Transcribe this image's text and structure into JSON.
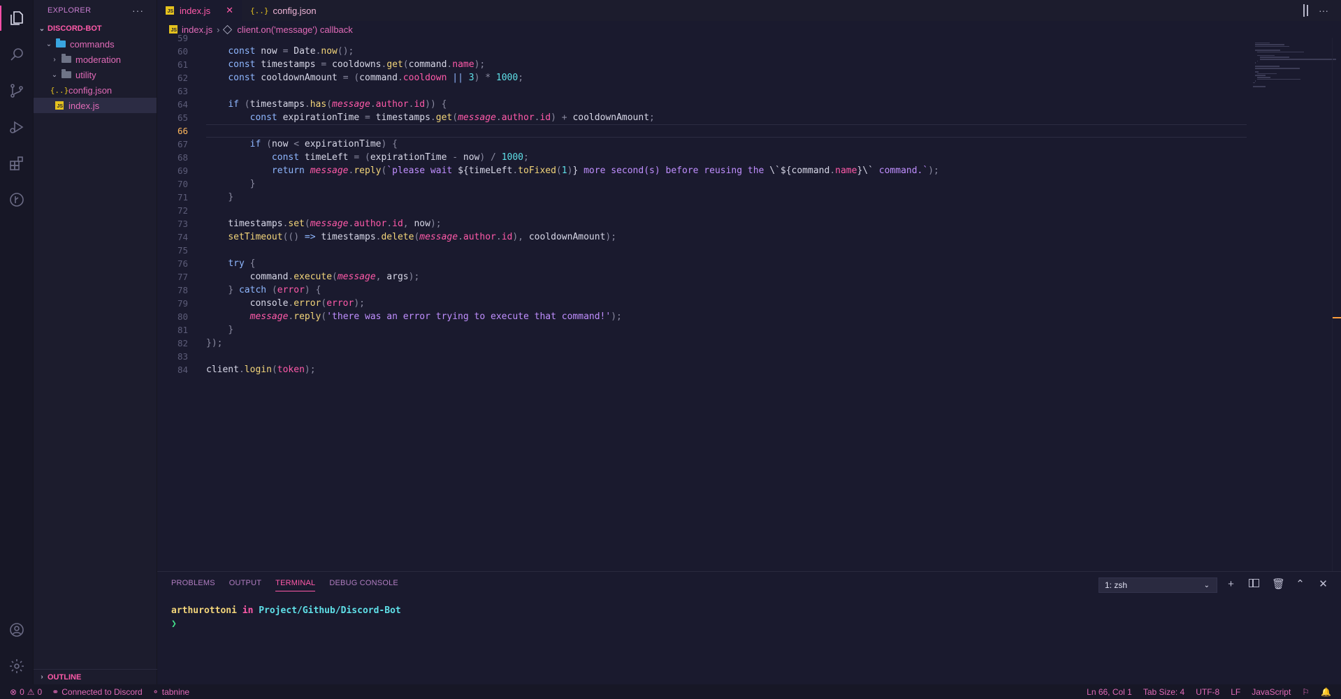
{
  "sidebar": {
    "title": "EXPLORER",
    "more": "···",
    "root": "DISCORD-BOT",
    "items": [
      {
        "label": "commands",
        "type": "folder-open"
      },
      {
        "label": "moderation",
        "type": "folder"
      },
      {
        "label": "utility",
        "type": "folder-open"
      },
      {
        "label": "config.json",
        "type": "json"
      },
      {
        "label": "index.js",
        "type": "js"
      }
    ],
    "outline": "OUTLINE"
  },
  "tabs": [
    {
      "label": "index.js",
      "active": true
    },
    {
      "label": "config.json",
      "active": false
    }
  ],
  "tab_close": "✕",
  "breadcrumb": {
    "file": "index.js",
    "symbol": "client.on('message') callback"
  },
  "editor": {
    "current_line": 66,
    "lines": [
      {
        "n": "59",
        "tokens": []
      },
      {
        "n": "60",
        "tokens": [
          [
            "tx",
            "    "
          ],
          [
            "kw",
            "const"
          ],
          [
            "tx",
            " now "
          ],
          [
            "op",
            "="
          ],
          [
            "tx",
            " Date"
          ],
          [
            "op",
            "."
          ],
          [
            "fn",
            "now"
          ],
          [
            "op",
            "();"
          ]
        ]
      },
      {
        "n": "61",
        "tokens": [
          [
            "tx",
            "    "
          ],
          [
            "kw",
            "const"
          ],
          [
            "tx",
            " timestamps "
          ],
          [
            "op",
            "="
          ],
          [
            "tx",
            " cooldowns"
          ],
          [
            "op",
            "."
          ],
          [
            "fn",
            "get"
          ],
          [
            "op",
            "("
          ],
          [
            "tx",
            "command"
          ],
          [
            "op",
            "."
          ],
          [
            "pr",
            "name"
          ],
          [
            "op",
            ");"
          ]
        ]
      },
      {
        "n": "62",
        "tokens": [
          [
            "tx",
            "    "
          ],
          [
            "kw",
            "const"
          ],
          [
            "tx",
            " cooldownAmount "
          ],
          [
            "op",
            "="
          ],
          [
            "tx",
            " "
          ],
          [
            "op",
            "("
          ],
          [
            "tx",
            "command"
          ],
          [
            "op",
            "."
          ],
          [
            "pr",
            "cooldown"
          ],
          [
            "tx",
            " "
          ],
          [
            "kw",
            "||"
          ],
          [
            "tx",
            " "
          ],
          [
            "num",
            "3"
          ],
          [
            "op",
            ")"
          ],
          [
            "tx",
            " "
          ],
          [
            "op",
            "*"
          ],
          [
            "tx",
            " "
          ],
          [
            "num",
            "1000"
          ],
          [
            "op",
            ";"
          ]
        ]
      },
      {
        "n": "63",
        "tokens": []
      },
      {
        "n": "64",
        "tokens": [
          [
            "tx",
            "    "
          ],
          [
            "kw",
            "if"
          ],
          [
            "tx",
            " "
          ],
          [
            "op",
            "("
          ],
          [
            "tx",
            "timestamps"
          ],
          [
            "op",
            "."
          ],
          [
            "fn",
            "has"
          ],
          [
            "op",
            "("
          ],
          [
            "it",
            "message"
          ],
          [
            "op",
            "."
          ],
          [
            "pr",
            "author"
          ],
          [
            "op",
            "."
          ],
          [
            "pr",
            "id"
          ],
          [
            "op",
            "))"
          ],
          [
            "tx",
            " "
          ],
          [
            "op",
            "{"
          ]
        ]
      },
      {
        "n": "65",
        "tokens": [
          [
            "tx",
            "        "
          ],
          [
            "kw",
            "const"
          ],
          [
            "tx",
            " expirationTime "
          ],
          [
            "op",
            "="
          ],
          [
            "tx",
            " timestamps"
          ],
          [
            "op",
            "."
          ],
          [
            "fn",
            "get"
          ],
          [
            "op",
            "("
          ],
          [
            "it",
            "message"
          ],
          [
            "op",
            "."
          ],
          [
            "pr",
            "author"
          ],
          [
            "op",
            "."
          ],
          [
            "pr",
            "id"
          ],
          [
            "op",
            ")"
          ],
          [
            "tx",
            " "
          ],
          [
            "op",
            "+"
          ],
          [
            "tx",
            " cooldownAmount"
          ],
          [
            "op",
            ";"
          ]
        ]
      },
      {
        "n": "66",
        "tokens": []
      },
      {
        "n": "67",
        "tokens": [
          [
            "tx",
            "        "
          ],
          [
            "kw",
            "if"
          ],
          [
            "tx",
            " "
          ],
          [
            "op",
            "("
          ],
          [
            "tx",
            "now "
          ],
          [
            "op",
            "<"
          ],
          [
            "tx",
            " expirationTime"
          ],
          [
            "op",
            ")"
          ],
          [
            "tx",
            " "
          ],
          [
            "op",
            "{"
          ]
        ]
      },
      {
        "n": "68",
        "tokens": [
          [
            "tx",
            "            "
          ],
          [
            "kw",
            "const"
          ],
          [
            "tx",
            " timeLeft "
          ],
          [
            "op",
            "="
          ],
          [
            "tx",
            " "
          ],
          [
            "op",
            "("
          ],
          [
            "tx",
            "expirationTime "
          ],
          [
            "op",
            "-"
          ],
          [
            "tx",
            " now"
          ],
          [
            "op",
            ")"
          ],
          [
            "tx",
            " "
          ],
          [
            "op",
            "/"
          ],
          [
            "tx",
            " "
          ],
          [
            "num",
            "1000"
          ],
          [
            "op",
            ";"
          ]
        ]
      },
      {
        "n": "69",
        "tokens": [
          [
            "tx",
            "            "
          ],
          [
            "kw",
            "return"
          ],
          [
            "tx",
            " "
          ],
          [
            "it",
            "message"
          ],
          [
            "op",
            "."
          ],
          [
            "fn",
            "reply"
          ],
          [
            "op",
            "("
          ],
          [
            "str",
            "`please wait "
          ],
          [
            "tx",
            "${timeLeft"
          ],
          [
            "op",
            "."
          ],
          [
            "fn",
            "toFixed"
          ],
          [
            "op",
            "("
          ],
          [
            "num",
            "1"
          ],
          [
            "op",
            ")"
          ],
          [
            "tx",
            "}"
          ],
          [
            "str",
            " more second(s) before reusing the "
          ],
          [
            "tx",
            "\\`${command"
          ],
          [
            "op",
            "."
          ],
          [
            "pr",
            "name"
          ],
          [
            "tx",
            "}\\`"
          ],
          [
            "str",
            " command.`"
          ],
          [
            "op",
            ");"
          ]
        ]
      },
      {
        "n": "70",
        "tokens": [
          [
            "tx",
            "        "
          ],
          [
            "op",
            "}"
          ]
        ]
      },
      {
        "n": "71",
        "tokens": [
          [
            "tx",
            "    "
          ],
          [
            "op",
            "}"
          ]
        ]
      },
      {
        "n": "72",
        "tokens": []
      },
      {
        "n": "73",
        "tokens": [
          [
            "tx",
            "    timestamps"
          ],
          [
            "op",
            "."
          ],
          [
            "fn",
            "set"
          ],
          [
            "op",
            "("
          ],
          [
            "it",
            "message"
          ],
          [
            "op",
            "."
          ],
          [
            "pr",
            "author"
          ],
          [
            "op",
            "."
          ],
          [
            "pr",
            "id"
          ],
          [
            "op",
            ","
          ],
          [
            "tx",
            " now"
          ],
          [
            "op",
            ");"
          ]
        ]
      },
      {
        "n": "74",
        "tokens": [
          [
            "tx",
            "    "
          ],
          [
            "fn",
            "setTimeout"
          ],
          [
            "op",
            "(()"
          ],
          [
            "tx",
            " "
          ],
          [
            "kw",
            "=>"
          ],
          [
            "tx",
            " timestamps"
          ],
          [
            "op",
            "."
          ],
          [
            "fn",
            "delete"
          ],
          [
            "op",
            "("
          ],
          [
            "it",
            "message"
          ],
          [
            "op",
            "."
          ],
          [
            "pr",
            "author"
          ],
          [
            "op",
            "."
          ],
          [
            "pr",
            "id"
          ],
          [
            "op",
            "),"
          ],
          [
            "tx",
            " cooldownAmount"
          ],
          [
            "op",
            ");"
          ]
        ]
      },
      {
        "n": "75",
        "tokens": []
      },
      {
        "n": "76",
        "tokens": [
          [
            "tx",
            "    "
          ],
          [
            "kw",
            "try"
          ],
          [
            "tx",
            " "
          ],
          [
            "op",
            "{"
          ]
        ]
      },
      {
        "n": "77",
        "tokens": [
          [
            "tx",
            "        command"
          ],
          [
            "op",
            "."
          ],
          [
            "fn",
            "execute"
          ],
          [
            "op",
            "("
          ],
          [
            "it",
            "message"
          ],
          [
            "op",
            ","
          ],
          [
            "tx",
            " args"
          ],
          [
            "op",
            ");"
          ]
        ]
      },
      {
        "n": "78",
        "tokens": [
          [
            "tx",
            "    "
          ],
          [
            "op",
            "}"
          ],
          [
            "tx",
            " "
          ],
          [
            "kw",
            "catch"
          ],
          [
            "tx",
            " "
          ],
          [
            "op",
            "("
          ],
          [
            "pr",
            "error"
          ],
          [
            "op",
            ")"
          ],
          [
            "tx",
            " "
          ],
          [
            "op",
            "{"
          ]
        ]
      },
      {
        "n": "79",
        "tokens": [
          [
            "tx",
            "        console"
          ],
          [
            "op",
            "."
          ],
          [
            "fn",
            "error"
          ],
          [
            "op",
            "("
          ],
          [
            "pr",
            "error"
          ],
          [
            "op",
            ");"
          ]
        ]
      },
      {
        "n": "80",
        "tokens": [
          [
            "tx",
            "        "
          ],
          [
            "it",
            "message"
          ],
          [
            "op",
            "."
          ],
          [
            "fn",
            "reply"
          ],
          [
            "op",
            "("
          ],
          [
            "str",
            "'there was an error trying to execute that command!'"
          ],
          [
            "op",
            ");"
          ]
        ]
      },
      {
        "n": "81",
        "tokens": [
          [
            "tx",
            "    "
          ],
          [
            "op",
            "}"
          ]
        ]
      },
      {
        "n": "82",
        "tokens": [
          [
            "op",
            "});"
          ]
        ]
      },
      {
        "n": "83",
        "tokens": []
      },
      {
        "n": "84",
        "tokens": [
          [
            "tx",
            "client"
          ],
          [
            "op",
            "."
          ],
          [
            "fn",
            "login"
          ],
          [
            "op",
            "("
          ],
          [
            "pr",
            "token"
          ],
          [
            "op",
            ");"
          ]
        ]
      }
    ]
  },
  "panel": {
    "tabs": [
      "PROBLEMS",
      "OUTPUT",
      "TERMINAL",
      "DEBUG CONSOLE"
    ],
    "active_tab": "TERMINAL",
    "terminal_select": "1: zsh",
    "terminal": {
      "user": "arthurottoni",
      "in": "in",
      "path": "Project/Github/Discord-Bot",
      "prompt": "❯"
    }
  },
  "status": {
    "errors": "0",
    "warnings": "0",
    "discord": "Connected to Discord",
    "tabnine": "tabnine",
    "position": "Ln 66, Col 1",
    "tab_size": "Tab Size: 4",
    "encoding": "UTF-8",
    "eol": "LF",
    "language": "JavaScript"
  },
  "colors": {
    "accent": "#ff5aa9",
    "background": "#1a1a2e",
    "current_line_number": "#ffb75c"
  }
}
